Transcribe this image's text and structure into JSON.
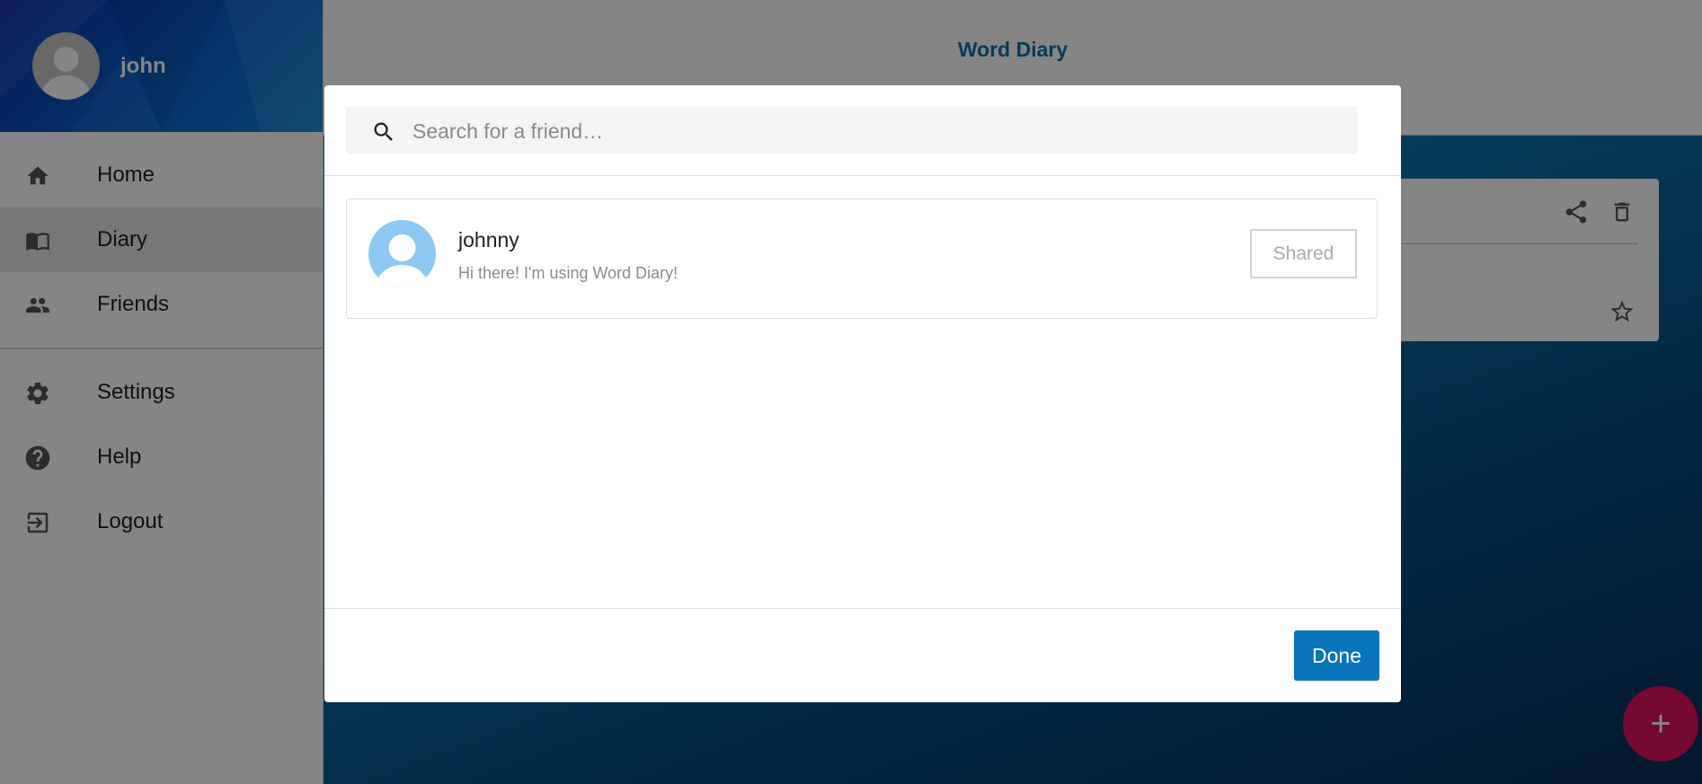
{
  "app": {
    "title": "Word Diary"
  },
  "user": {
    "name": "john"
  },
  "sidebar": {
    "items": [
      {
        "label": "Home",
        "icon": "home-icon"
      },
      {
        "label": "Diary",
        "icon": "book-icon",
        "active": true
      },
      {
        "label": "Friends",
        "icon": "people-icon"
      },
      {
        "label": "Settings",
        "icon": "gear-icon"
      },
      {
        "label": "Help",
        "icon": "help-icon"
      },
      {
        "label": "Logout",
        "icon": "logout-icon"
      }
    ]
  },
  "entry_card": {
    "icons": [
      "share-icon",
      "delete-icon",
      "star-icon"
    ]
  },
  "fab": {
    "label": "+"
  },
  "dialog": {
    "search": {
      "placeholder": "Search for a friend…",
      "value": ""
    },
    "friends": [
      {
        "name": "johnny",
        "status": "Hi there! I'm using Word Diary!",
        "button": "Shared"
      }
    ],
    "done_label": "Done"
  },
  "colors": {
    "accent": "#0a74bd",
    "title": "#0a6fb0",
    "fab": "#e0105c",
    "friend_avatar": "#8cc8f2"
  }
}
